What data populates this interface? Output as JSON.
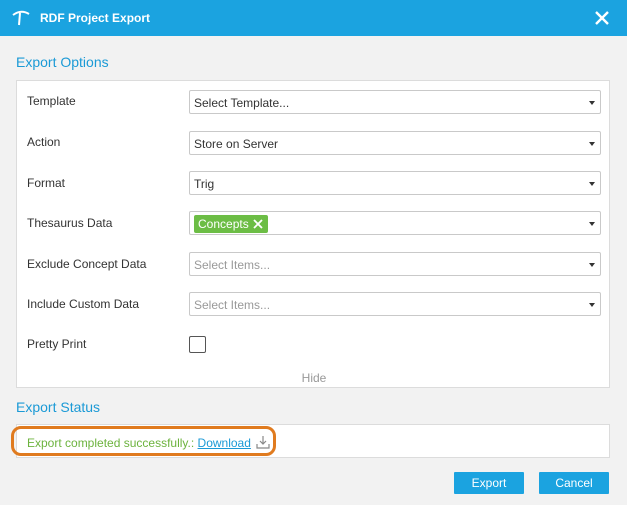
{
  "window": {
    "title": "RDF Project Export",
    "logo_icon": "app-logo-icon",
    "close_icon": "close-icon"
  },
  "export_options": {
    "heading": "Export Options",
    "fields": {
      "template": {
        "label": "Template",
        "value": "Select Template..."
      },
      "action": {
        "label": "Action",
        "value": "Store on Server"
      },
      "format": {
        "label": "Format",
        "value": "Trig"
      },
      "thesaurus": {
        "label": "Thesaurus Data",
        "tag": "Concepts"
      },
      "exclude": {
        "label": "Exclude Concept Data",
        "placeholder": "Select Items..."
      },
      "include": {
        "label": "Include Custom Data",
        "placeholder": "Select Items..."
      },
      "pretty_print": {
        "label": "Pretty Print",
        "checked": false
      }
    },
    "hide_label": "Hide"
  },
  "export_status": {
    "heading": "Export Status",
    "message": "Export completed successfully.:",
    "download_label": "Download",
    "download_icon": "download-icon"
  },
  "buttons": {
    "export": "Export",
    "cancel": "Cancel"
  },
  "colors": {
    "accent": "#1ba3e0",
    "success": "#6cbd45",
    "highlight": "#e07b1f"
  }
}
